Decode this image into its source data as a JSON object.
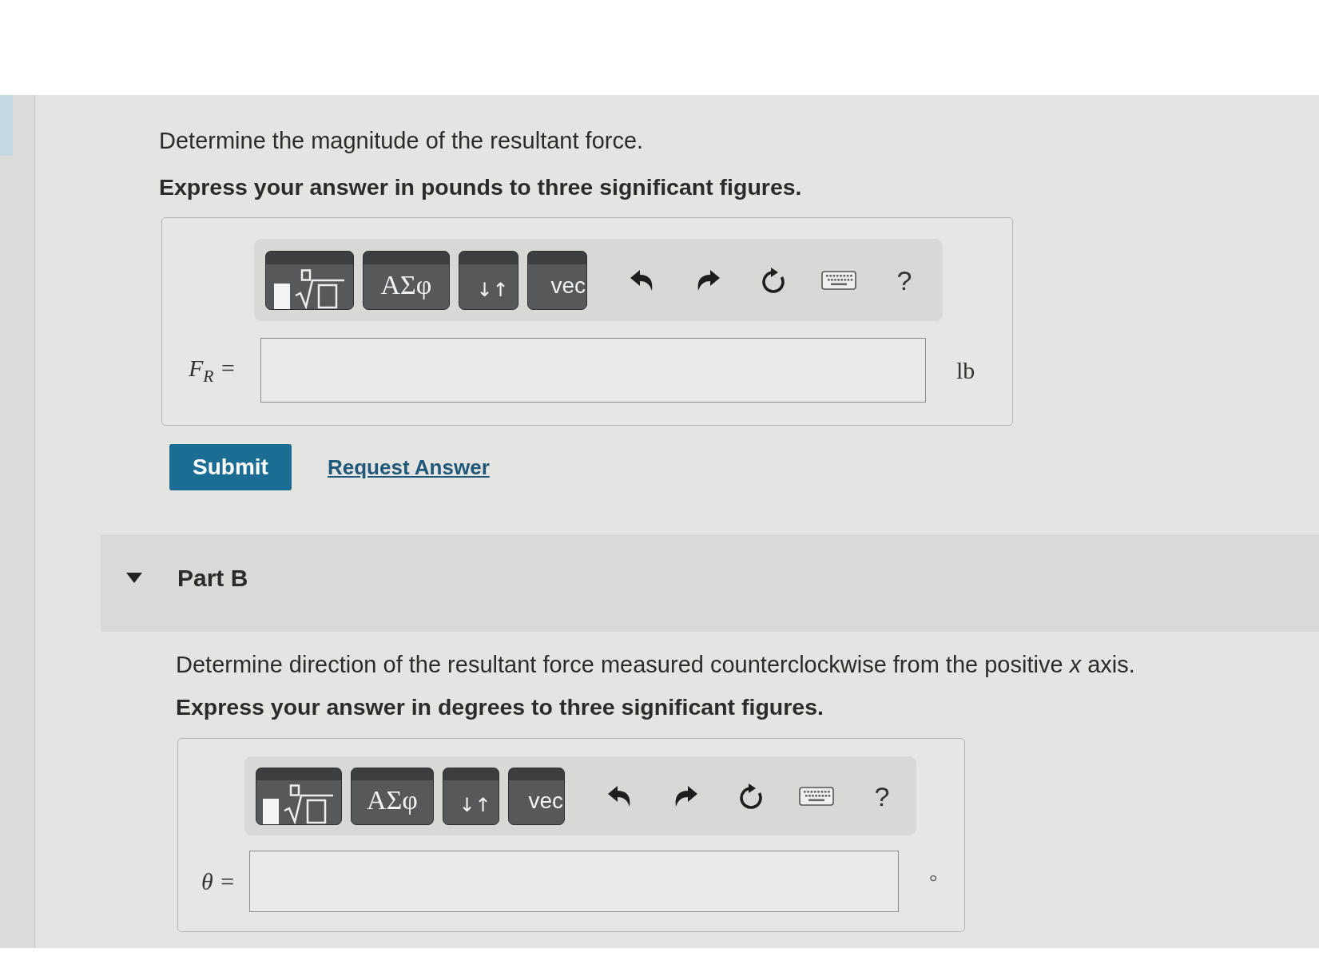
{
  "part_a": {
    "prompt": "Determine the magnitude of the resultant force.",
    "instruction": "Express your answer in pounds to three significant figures.",
    "toolbar": [
      {
        "kind": "templates"
      },
      {
        "kind": "greek",
        "label": "ΑΣφ"
      },
      {
        "kind": "arrows",
        "label": "↓↑"
      },
      {
        "kind": "vector",
        "label": "vec"
      },
      {
        "kind": "undo"
      },
      {
        "kind": "redo"
      },
      {
        "kind": "reset"
      },
      {
        "kind": "keyboard"
      },
      {
        "kind": "help",
        "label": "?"
      }
    ],
    "variable": "F$_{R}$ =",
    "unit": "lb",
    "actions": [
      {
        "kind": "submit",
        "label": "Submit"
      },
      {
        "kind": "link",
        "label": "Request Answer"
      }
    ]
  },
  "part_b": {
    "title": "Part B",
    "expanded": true,
    "prompt": "Determine direction of the resultant force measured counterclockwise from the positive *x* axis.",
    "instruction": "Express your answer in degrees to three significant figures.",
    "toolbar": [
      {
        "kind": "templates"
      },
      {
        "kind": "greek",
        "label": "ΑΣφ"
      },
      {
        "kind": "arrows",
        "label": "↓↑"
      },
      {
        "kind": "vector",
        "label": "vec"
      },
      {
        "kind": "undo"
      },
      {
        "kind": "redo"
      },
      {
        "kind": "reset"
      },
      {
        "kind": "keyboard"
      },
      {
        "kind": "help",
        "label": "?"
      }
    ],
    "variable": "θ =",
    "unit": "°"
  }
}
